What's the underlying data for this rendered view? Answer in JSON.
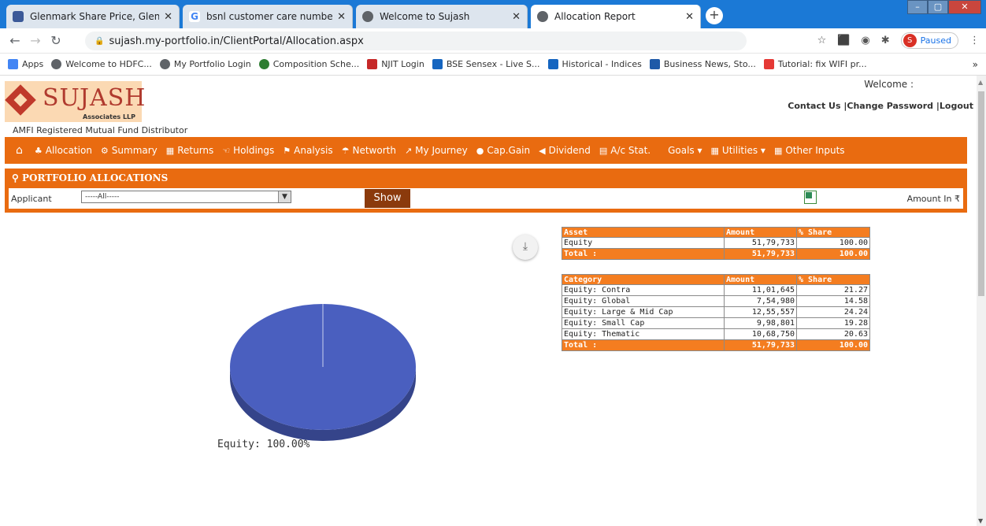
{
  "browser": {
    "tabs": [
      {
        "title": "Glenmark Share Price, Glenmark",
        "color": "#3b5998"
      },
      {
        "title": "bsnl customer care number - Goo",
        "color": "#ffffff"
      },
      {
        "title": "Welcome to Sujash",
        "color": "#5f6368"
      },
      {
        "title": "Allocation Report",
        "color": "#5f6368"
      }
    ],
    "url": "sujash.my-portfolio.in/ClientPortal/Allocation.aspx",
    "profile_initial": "S",
    "profile_status": "Paused",
    "bookmarks": [
      {
        "label": "Apps",
        "color": "#4285f4"
      },
      {
        "label": "Welcome to HDFC...",
        "color": "#5f6368"
      },
      {
        "label": "My Portfolio Login",
        "color": "#5f6368"
      },
      {
        "label": "Composition Sche...",
        "color": "#2e7d32"
      },
      {
        "label": "NJIT Login",
        "color": "#c62828"
      },
      {
        "label": "BSE Sensex - Live S...",
        "color": "#1565c0"
      },
      {
        "label": "Historical - Indices",
        "color": "#1565c0"
      },
      {
        "label": "Business News, Sto...",
        "color": "#1e5aa8"
      },
      {
        "label": "Tutorial: fix WIFI pr...",
        "color": "#e53935"
      }
    ],
    "bookmarks_more": "»"
  },
  "header": {
    "logo_name": "SUJASH",
    "logo_sub": "Associates LLP",
    "tagline": "AMFI Registered Mutual Fund Distributor",
    "welcome": "Welcome :",
    "links": [
      "Contact Us",
      "Change Password",
      "Logout"
    ]
  },
  "nav": {
    "items": [
      {
        "label": "",
        "icon": "home-icon"
      },
      {
        "label": "Allocation",
        "icon": "allocation-icon"
      },
      {
        "label": "Summary",
        "icon": "cogs-icon"
      },
      {
        "label": "Returns",
        "icon": "grid-icon"
      },
      {
        "label": "Holdings",
        "icon": "hand-icon"
      },
      {
        "label": "Analysis",
        "icon": "flag-icon"
      },
      {
        "label": "Networth",
        "icon": "umbrella-icon"
      },
      {
        "label": "My Journey",
        "icon": "chart-icon"
      },
      {
        "label": "Cap.Gain",
        "icon": "comment-icon"
      },
      {
        "label": "Dividend",
        "icon": "bullhorn-icon"
      },
      {
        "label": "A/c Stat.",
        "icon": "document-icon"
      },
      {
        "label": "Goals ▾",
        "icon": ""
      },
      {
        "label": "Utilities ▾",
        "icon": "grid-icon"
      },
      {
        "label": "Other Inputs",
        "icon": "grid-icon"
      }
    ]
  },
  "panel": {
    "title": "PORTFOLIO ALLOCATIONS",
    "applicant_label": "Applicant",
    "applicant_value": "-----All-----",
    "show_button": "Show",
    "amount_label": "Amount In ₹"
  },
  "chart_data": {
    "type": "pie",
    "slices": [
      {
        "label": "Equity",
        "value": 100.0,
        "color": "#4a5fbf"
      }
    ],
    "data_label": "Equity: 100.00%"
  },
  "asset_table": {
    "headers": [
      "Asset",
      "Amount",
      "% Share"
    ],
    "rows": [
      [
        "Equity",
        "51,79,733",
        "100.00"
      ]
    ],
    "total": [
      "Total :",
      "51,79,733",
      "100.00"
    ]
  },
  "category_table": {
    "headers": [
      "Category",
      "Amount",
      "% Share"
    ],
    "rows": [
      [
        "Equity: Contra",
        "11,01,645",
        "21.27"
      ],
      [
        "Equity: Global",
        "7,54,980",
        "14.58"
      ],
      [
        "Equity: Large & Mid Cap",
        "12,55,557",
        "24.24"
      ],
      [
        "Equity: Small Cap",
        "9,98,801",
        "19.28"
      ],
      [
        "Equity: Thematic",
        "10,68,750",
        "20.63"
      ]
    ],
    "total": [
      "Total :",
      "51,79,733",
      "100.00"
    ]
  }
}
